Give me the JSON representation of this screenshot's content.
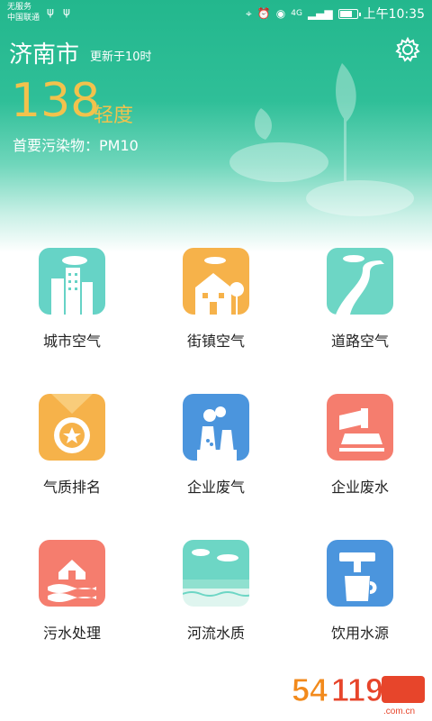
{
  "status_bar": {
    "carrier_line1": "无服务",
    "carrier_line2": "中国联通",
    "network": "4G",
    "time": "上午10:35",
    "battery_level": 0.8
  },
  "header": {
    "city": "济南市",
    "updated": "更新于10时",
    "aqi": "138",
    "level": "轻度",
    "pollutant": "首要污染物：PM10"
  },
  "tiles": [
    {
      "label": "城市空气",
      "icon": "city-icon",
      "color": "#66d3c6"
    },
    {
      "label": "街镇空气",
      "icon": "house-icon",
      "color": "#f6b24a"
    },
    {
      "label": "道路空气",
      "icon": "road-icon",
      "color": "#6dd6c5"
    },
    {
      "label": "气质排名",
      "icon": "medal-icon",
      "color": "#f6b24a"
    },
    {
      "label": "企业废气",
      "icon": "factory-icon",
      "color": "#4b95dd"
    },
    {
      "label": "企业废水",
      "icon": "pipe-icon",
      "color": "#f57d6e"
    },
    {
      "label": "污水处理",
      "icon": "sewage-icon",
      "color": "#f57d6e"
    },
    {
      "label": "河流水质",
      "icon": "river-icon",
      "color": "#6dd6c5"
    },
    {
      "label": "饮用水源",
      "icon": "tap-icon",
      "color": "#4b95dd"
    }
  ],
  "watermark": {
    "brand": "54119手游网",
    "domain": "www.54119.com.cn"
  }
}
